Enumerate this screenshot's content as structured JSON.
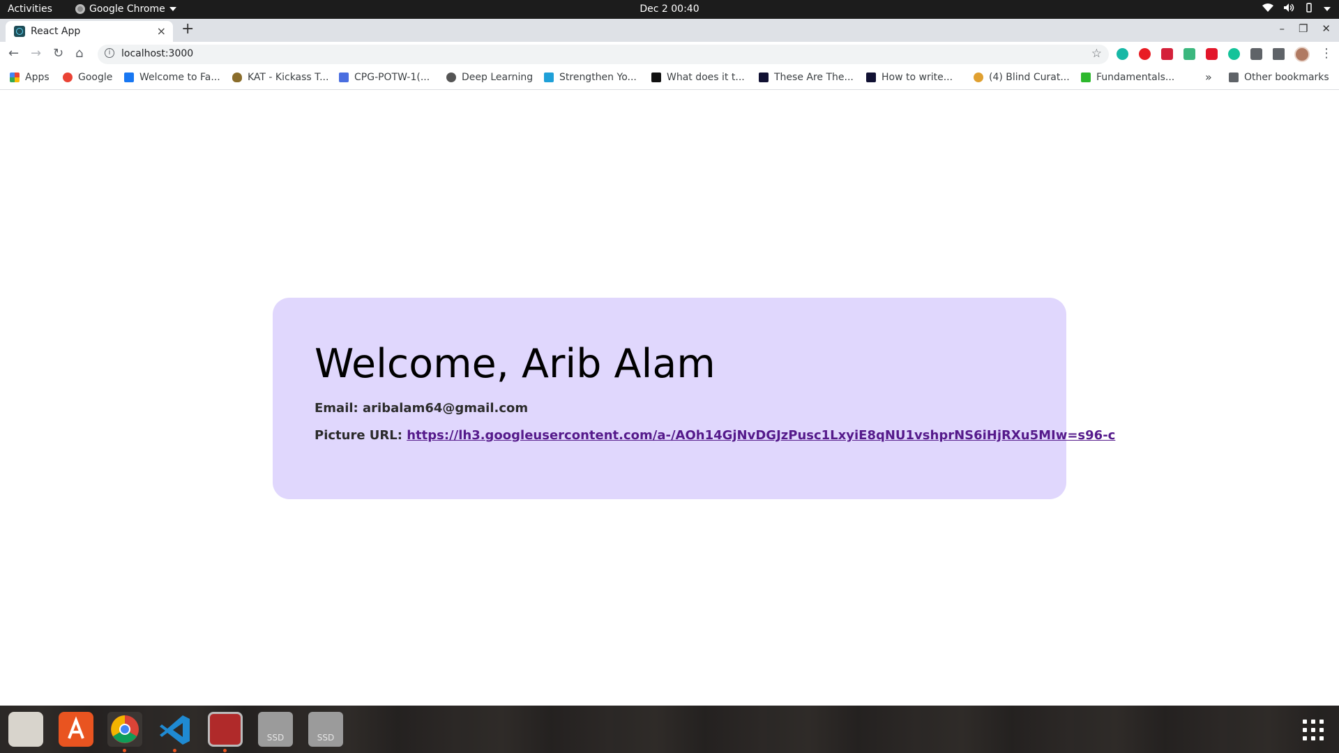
{
  "system_bar": {
    "activities": "Activities",
    "app_name": "Google Chrome",
    "clock": "Dec 2  00:40"
  },
  "browser": {
    "tab": {
      "title": "React App",
      "close": "×"
    },
    "new_tab": "+",
    "address": "localhost:3000",
    "bookmarks": [
      {
        "label": "Apps",
        "icon": "apps-grid-icon",
        "color": "#4285f4"
      },
      {
        "label": "Google",
        "icon": "google-icon",
        "color": "#ea4335"
      },
      {
        "label": "Welcome to Fa...",
        "icon": "facebook-icon",
        "color": "#1877f2"
      },
      {
        "label": "KAT - Kickass T...",
        "icon": "kat-icon",
        "color": "#8a6d2b"
      },
      {
        "label": "CPG-POTW-1(...",
        "icon": "docs-icon",
        "color": "#4a6ee0"
      },
      {
        "label": "Deep Learning",
        "icon": "globe-icon",
        "color": "#555555"
      },
      {
        "label": "Strengthen Yo...",
        "icon": "udemy-icon",
        "color": "#1fa0d8"
      },
      {
        "label": "What does it t...",
        "icon": "medium-icon",
        "color": "#111111"
      },
      {
        "label": "These Are The...",
        "icon": "site-icon",
        "color": "#111133"
      },
      {
        "label": "How to write...",
        "icon": "site-icon",
        "color": "#111133"
      },
      {
        "label": "(4) Blind Curat...",
        "icon": "blind-icon",
        "color": "#e0a030"
      },
      {
        "label": "Fundamentals...",
        "icon": "leaf-icon",
        "color": "#2db82d"
      }
    ],
    "more": "»",
    "other_bookmarks": "Other bookmarks"
  },
  "page": {
    "heading": "Welcome, Arib Alam",
    "email_label": "Email:",
    "email_value": "aribalam64@gmail.com",
    "picture_label": "Picture URL:",
    "picture_url": "https://lh3.googleusercontent.com/a-/AOh14GjNvDGJzPusc1LxyiE8qNU1vshprNS6iHjRXu5MIw=s96-c"
  },
  "dock": {
    "items": [
      {
        "name": "files",
        "color": "#d8d4cc"
      },
      {
        "name": "software-center",
        "color": "#e95420"
      },
      {
        "name": "chrome",
        "color": "#4285f4"
      },
      {
        "name": "vscode",
        "color": "#1f8ad2"
      },
      {
        "name": "terminal",
        "color": "#b02a2a"
      }
    ],
    "ssd_label": "SSD"
  },
  "colors": {
    "card_background": "#e0d7fd",
    "link": "#551a8b"
  }
}
